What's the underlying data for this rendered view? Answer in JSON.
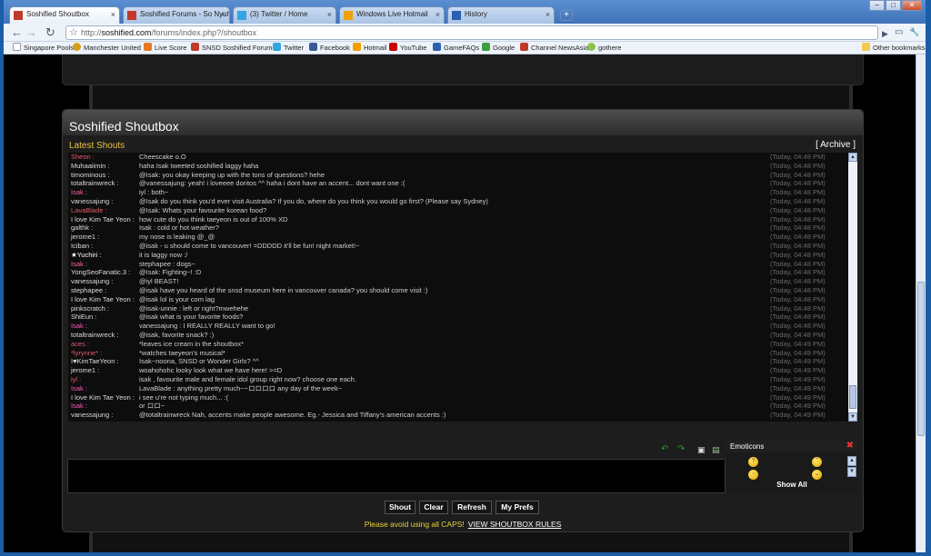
{
  "browser": {
    "tabs": [
      {
        "label": "Soshified Shoutbox",
        "active": true,
        "favicon_color": "#c0392b"
      },
      {
        "label": "Soshified Forums - So Nyuh...",
        "active": false,
        "favicon_color": "#c0392b"
      },
      {
        "label": "(3) Twitter / Home",
        "active": false,
        "favicon_color": "#33a5e0"
      },
      {
        "label": "Windows Live Hotmail",
        "active": false,
        "favicon_color": "#f0a000"
      },
      {
        "label": "History",
        "active": false,
        "favicon_color": "#2b5fb0"
      }
    ],
    "new_tab": "+",
    "tab_close": "×",
    "window_buttons": {
      "minimize": "–",
      "maximize": "□",
      "close": "✕"
    },
    "nav": {
      "back": "←",
      "forward": "→",
      "reload": "↻",
      "star": "☆",
      "go": "▶",
      "page_menu": "▭",
      "tools_menu": "🔧"
    },
    "url_scheme": "http://",
    "url_host": "soshified.com",
    "url_path": "/forums/index.php?/shoutbox",
    "bookmarks": [
      {
        "label": "Singapore Pools",
        "color": "#ffffff"
      },
      {
        "label": "Manchester United",
        "color": "#d4a017"
      },
      {
        "label": "Live Score",
        "color": "#e87722"
      },
      {
        "label": "SNSD Soshified Forums",
        "color": "#c0392b"
      },
      {
        "label": "Twitter",
        "color": "#33a5e0"
      },
      {
        "label": "Facebook",
        "color": "#3b5998"
      },
      {
        "label": "Hotmail",
        "color": "#f0a000"
      },
      {
        "label": "YouTube",
        "color": "#cc0000"
      },
      {
        "label": "GameFAQs",
        "color": "#2b5fb0"
      },
      {
        "label": "Google",
        "color": "#3c9f40"
      },
      {
        "label": "Channel NewsAsia",
        "color": "#c0392b"
      },
      {
        "label": "gothere",
        "color": "#8bc34a"
      }
    ],
    "other_bookmarks": "Other bookmarks"
  },
  "shoutbox": {
    "title": "Soshified Shoutbox",
    "latest_label": "Latest Shouts",
    "archive_open": "[",
    "archive_label": "Archive",
    "archive_close": "]",
    "shouts": [
      {
        "user": "Sheon :",
        "color": "#e05c6a",
        "message": "Cheescake o.O",
        "time": "(Today, 04:48 PM)"
      },
      {
        "user": "Muhaaiimin :",
        "color": "#dcdcdc",
        "message": "haha Isak tweeted soshified laggy haha",
        "time": "(Today, 04:48 PM)"
      },
      {
        "user": "timominous :",
        "color": "#dcdcdc",
        "message": "@Isak: you okay keeping up with the tons of questions? hehe",
        "time": "(Today, 04:48 PM)"
      },
      {
        "user": "totaltrainwreck :",
        "color": "#dcdcdc",
        "message": "@vanessajung: yeah! i loveeee doritos ^^ haha i dont have an accent... dont want one :(",
        "time": "(Today, 04:48 PM)"
      },
      {
        "user": "Isak :",
        "color": "#ff5fb4",
        "message": "iyl : both~",
        "time": "(Today, 04:48 PM)"
      },
      {
        "user": "vanessajung :",
        "color": "#dcdcdc",
        "message": "@Isak do you think you'd ever visit Australia? If you do, where do you think you would go first? (Please say Sydney)",
        "time": "(Today, 04:48 PM)"
      },
      {
        "user": "LavaBlade :",
        "color": "#e05c6a",
        "message": "@Isak: Whats your favourite korean food?",
        "time": "(Today, 04:48 PM)"
      },
      {
        "user": "I love Kim Tae Yeon :",
        "color": "#dcdcdc",
        "message": "how cute do you think taeyeon is out of 100% XD",
        "time": "(Today, 04:48 PM)"
      },
      {
        "user": "galthk :",
        "color": "#dcdcdc",
        "message": "Isak : cold or hot weather?",
        "time": "(Today, 04:48 PM)"
      },
      {
        "user": "jerome1 :",
        "color": "#dcdcdc",
        "message": "my nose is leaking @_@",
        "time": "(Today, 04:48 PM)"
      },
      {
        "user": "Iciban :",
        "color": "#dcdcdc",
        "message": "@isak - u should come to vancouver! =DDDDD it'll be fun! night market!~",
        "time": "(Today, 04:48 PM)"
      },
      {
        "user": "★Yuchiri :",
        "color": "#ffffff",
        "message": "it is laggy now :/",
        "time": "(Today, 04:48 PM)"
      },
      {
        "user": "Isak :",
        "color": "#ff5fb4",
        "message": "stephapee : dogs~",
        "time": "(Today, 04:48 PM)"
      },
      {
        "user": "YongSeoFanatic.3 :",
        "color": "#dcdcdc",
        "message": "@Isak: Fighting~! :D",
        "time": "(Today, 04:48 PM)"
      },
      {
        "user": "vanessajung :",
        "color": "#dcdcdc",
        "message": "@iyl BEAST!",
        "time": "(Today, 04:48 PM)"
      },
      {
        "user": "stephapee :",
        "color": "#dcdcdc",
        "message": "@isak have you heard of the snsd museum here in vancouver canada? you should come visit :)",
        "time": "(Today, 04:48 PM)"
      },
      {
        "user": "I love Kim Tae Yeon :",
        "color": "#dcdcdc",
        "message": "@isak lol is your com lag",
        "time": "(Today, 04:48 PM)"
      },
      {
        "user": "pinkscratch :",
        "color": "#dcdcdc",
        "message": "@isak-unnie : left or right?mwehehe",
        "time": "(Today, 04:48 PM)"
      },
      {
        "user": "ShiEun :",
        "color": "#dcdcdc",
        "message": "@isak what is your favorite foods?",
        "time": "(Today, 04:48 PM)"
      },
      {
        "user": "Isak :",
        "color": "#ff5fb4",
        "message": "vanessajung : I REALLY REALLY want to go!",
        "time": "(Today, 04:48 PM)"
      },
      {
        "user": "totaltrainwreck :",
        "color": "#dcdcdc",
        "message": "@isak, favorite snack? :)",
        "time": "(Today, 04:48 PM)"
      },
      {
        "user": "aces :",
        "color": "#e05c6a",
        "message": "*leaves ice cream in the shoutbox*",
        "time": "(Today, 04:49 PM)"
      },
      {
        "user": "*lyrynne* :",
        "color": "#e05c6a",
        "message": "*watches taeyeon's musical*",
        "time": "(Today, 04:49 PM)"
      },
      {
        "user": "I♥KimTaeYeon :",
        "color": "#dcdcdc",
        "message": "Isak~noona, SNSD or Wonder Girls? ^^",
        "time": "(Today, 04:49 PM)"
      },
      {
        "user": "jerome1 :",
        "color": "#dcdcdc",
        "message": "woahohohc looky look what we have here! >=D",
        "time": "(Today, 04:49 PM)"
      },
      {
        "user": "iyl :",
        "color": "#e05c6a",
        "message": "isak , favourite male and female idol group right now? choose one each.",
        "time": "(Today, 04:49 PM)"
      },
      {
        "user": "Isak :",
        "color": "#ff5fb4",
        "message": "LavaBlade : anything pretty much~~ロロロロ any day of the week~",
        "time": "(Today, 04:49 PM)"
      },
      {
        "user": "I love Kim Tae Yeon :",
        "color": "#dcdcdc",
        "message": "i see u're not typing much... :(",
        "time": "(Today, 04:49 PM)"
      },
      {
        "user": "Isak :",
        "color": "#ff5fb4",
        "message": "or ロロ~",
        "time": "(Today, 04:49 PM)"
      },
      {
        "user": "vanessajung :",
        "color": "#dcdcdc",
        "message": "@totaltrainwreck Nah, accents make people awesome. Eg.- Jessica and Tiffany's american accents :)",
        "time": "(Today, 04:49 PM)"
      }
    ],
    "scroll_up": "▲",
    "scroll_down": "▼",
    "emoticons_title": "Emoticons",
    "emoticons_close": "✖",
    "show_all": "Show All",
    "buttons": {
      "shout": "Shout",
      "clear": "Clear",
      "refresh": "Refresh",
      "prefs": "My Prefs"
    },
    "rules_text": "Please avoid using all CAPS!",
    "rules_link": "VIEW SHOUTBOX RULES"
  }
}
